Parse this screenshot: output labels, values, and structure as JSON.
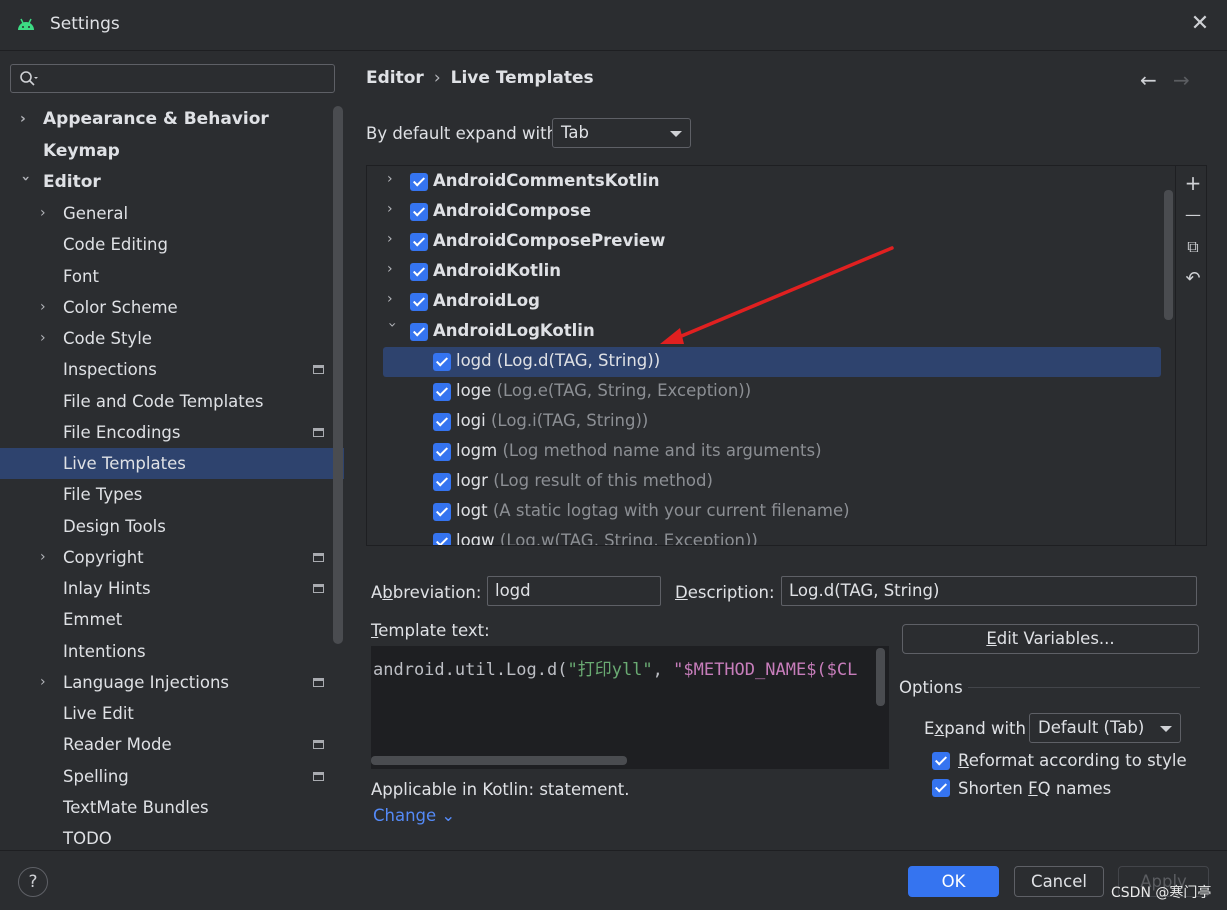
{
  "window": {
    "title": "Settings",
    "close_glyph": "✕"
  },
  "search": {
    "placeholder": ""
  },
  "sidebar": {
    "items": [
      {
        "label": "Appearance & Behavior"
      },
      {
        "label": "Keymap"
      },
      {
        "label": "Editor"
      },
      {
        "label": "General"
      },
      {
        "label": "Code Editing"
      },
      {
        "label": "Font"
      },
      {
        "label": "Color Scheme"
      },
      {
        "label": "Code Style"
      },
      {
        "label": "Inspections"
      },
      {
        "label": "File and Code Templates"
      },
      {
        "label": "File Encodings"
      },
      {
        "label": "Live Templates"
      },
      {
        "label": "File Types"
      },
      {
        "label": "Design Tools"
      },
      {
        "label": "Copyright"
      },
      {
        "label": "Inlay Hints"
      },
      {
        "label": "Emmet"
      },
      {
        "label": "Intentions"
      },
      {
        "label": "Language Injections"
      },
      {
        "label": "Live Edit"
      },
      {
        "label": "Reader Mode"
      },
      {
        "label": "Spelling"
      },
      {
        "label": "TextMate Bundles"
      },
      {
        "label": "TODO"
      }
    ]
  },
  "header": {
    "breadcrumb": [
      "Editor",
      "Live Templates"
    ],
    "separator": "›",
    "back_glyph": "←",
    "forward_glyph": "→"
  },
  "expand_default": {
    "label": "By default expand with",
    "value": "Tab"
  },
  "templates": {
    "groups": [
      {
        "name": "AndroidCommentsKotlin"
      },
      {
        "name": "AndroidCompose"
      },
      {
        "name": "AndroidComposePreview"
      },
      {
        "name": "AndroidKotlin"
      },
      {
        "name": "AndroidLog"
      },
      {
        "name": "AndroidLogKotlin"
      }
    ],
    "items": [
      {
        "abbr": "logd",
        "desc": "(Log.d(TAG, String))"
      },
      {
        "abbr": "loge",
        "desc": "(Log.e(TAG, String, Exception))"
      },
      {
        "abbr": "logi",
        "desc": "(Log.i(TAG, String))"
      },
      {
        "abbr": "logm",
        "desc": "(Log method name and its arguments)"
      },
      {
        "abbr": "logr",
        "desc": "(Log result of this method)"
      },
      {
        "abbr": "logt",
        "desc": "(A static logtag with your current filename)"
      },
      {
        "abbr": "logw",
        "desc": "(Log.w(TAG, String, Exception))"
      }
    ],
    "tools": {
      "add": "+",
      "remove": "—",
      "copy": "⧉",
      "restore": "↶"
    }
  },
  "details": {
    "abbreviation_label_pre": "A",
    "abbreviation_label_ul": "b",
    "abbreviation_label_post": "breviation:",
    "abbreviation_value": "logd",
    "description_label_ul": "D",
    "description_label_post": "escription:",
    "description_value": "Log.d(TAG, String)",
    "template_text_label_ul": "T",
    "template_text_label_post": "emplate text:",
    "code": {
      "part1": "android.util.Log.d(",
      "part2": "\"打印yll\"",
      "part3": ", ",
      "part4": "\"$METHOD_NAME$($CL"
    },
    "edit_variables_ul": "E",
    "edit_variables_post": "dit Variables...",
    "applicable": "Applicable in Kotlin: statement.",
    "change_link": "Change"
  },
  "options": {
    "title": "Options",
    "expand_label_pre": "E",
    "expand_label_ul": "x",
    "expand_label_post": "pand with",
    "expand_value": "Default (Tab)",
    "reformat_ul": "R",
    "reformat_post": "eformat according to style",
    "shorten_pre": "Shorten ",
    "shorten_ul": "F",
    "shorten_post": "Q names"
  },
  "footer": {
    "help": "?",
    "ok": "OK",
    "cancel": "Cancel",
    "apply": "Apply",
    "watermark": "CSDN @寒门亭"
  },
  "colors": {
    "background": "#2b2d30",
    "selection": "#2e436e",
    "accent": "#3574f0",
    "link": "#548af7",
    "annotation_arrow": "#e02020"
  }
}
